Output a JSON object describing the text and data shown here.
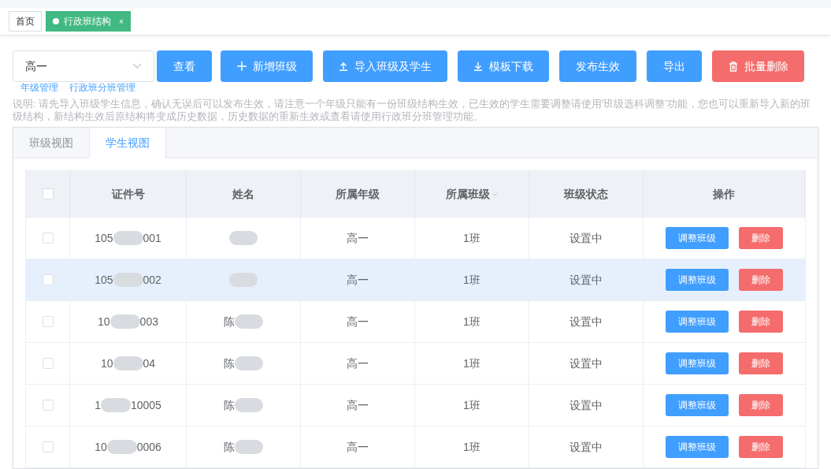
{
  "page_tabs": [
    {
      "label": "首页",
      "selected": false,
      "closable": false
    },
    {
      "label": "行政班结构",
      "selected": true,
      "closable": true,
      "close": "×"
    }
  ],
  "grade_select": {
    "value": "高一"
  },
  "toolbar": [
    {
      "label": "查看",
      "kind": "plain"
    },
    {
      "label": "新增班级",
      "kind": "add"
    },
    {
      "label": "导入班级及学生",
      "kind": "import"
    },
    {
      "label": "模板下载",
      "kind": "download"
    },
    {
      "label": "发布生效",
      "kind": "plain"
    },
    {
      "label": "导出",
      "kind": "plain"
    },
    {
      "label": "批量删除",
      "kind": "danger"
    }
  ],
  "links": [
    "年级管理",
    "行政班分班管理"
  ],
  "note": "说明: 请先导入班级学生信息，确认无误后可以发布生效，请注意一个年级只能有一份班级结构生效，已生效的学生需要调整请使用'班级选科调整'功能，您也可以重新导入新的班级结构，新结构生效后原结构将变成历史数据，历史数据的重新生效或查看请使用行政班分班管理功能。",
  "view_tabs": [
    {
      "label": "班级视图",
      "selected": false
    },
    {
      "label": "学生视图",
      "selected": true
    }
  ],
  "table": {
    "all_checked": false,
    "columns": [
      {
        "label": "证件号",
        "sortable": false
      },
      {
        "label": "姓名",
        "sortable": false
      },
      {
        "label": "所属年级",
        "sortable": false
      },
      {
        "label": "所属班级",
        "sortable": true
      },
      {
        "label": "班级状态",
        "sortable": false
      },
      {
        "label": "操作",
        "sortable": false
      }
    ],
    "rows": [
      {
        "checked": false,
        "highlighted": false,
        "id_start": "105",
        "id_end": "001",
        "grade": "高一",
        "class": "1班",
        "status": "设置中",
        "actions": [
          "调整班级",
          "删除"
        ]
      },
      {
        "checked": false,
        "highlighted": true,
        "id_start": "105",
        "id_end": "002",
        "grade": "高一",
        "class": "1班",
        "status": "设置中",
        "actions": [
          "调整班级",
          "删除"
        ]
      },
      {
        "checked": false,
        "highlighted": false,
        "id_start": "10",
        "id_end": "003",
        "name_start": "陈",
        "grade": "高一",
        "class": "1班",
        "status": "设置中",
        "actions": [
          "调整班级",
          "删除"
        ]
      },
      {
        "checked": false,
        "highlighted": false,
        "id_start": "10",
        "id_end": "04",
        "name_start": "陈",
        "grade": "高一",
        "class": "1班",
        "status": "设置中",
        "actions": [
          "调整班级",
          "删除"
        ]
      },
      {
        "checked": false,
        "highlighted": false,
        "id_start": "1",
        "id_end": "10005",
        "name_start": "陈",
        "grade": "高一",
        "class": "1班",
        "status": "设置中",
        "actions": [
          "调整班级",
          "删除"
        ]
      },
      {
        "checked": false,
        "highlighted": false,
        "id_start": "10",
        "id_end": "0006",
        "name_start": "陈",
        "grade": "高一",
        "class": "1班",
        "status": "设置中",
        "actions": [
          "调整班级",
          "删除"
        ]
      }
    ]
  }
}
